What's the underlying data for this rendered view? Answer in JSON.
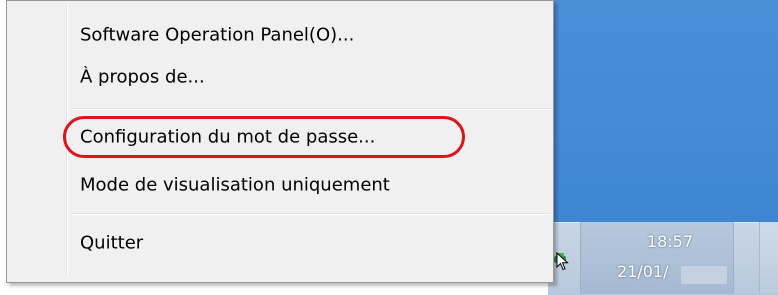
{
  "context_menu": {
    "items": [
      {
        "label": "Software Operation Panel(O)..."
      },
      {
        "label": "À propos de..."
      },
      {
        "label": "Configuration du mot de passe..."
      },
      {
        "label": "Mode de visualisation uniquement"
      },
      {
        "label": "Quitter"
      }
    ]
  },
  "taskbar": {
    "clock_time": "18:57",
    "clock_date": "21/01/"
  },
  "colors": {
    "menu_bg": "#f0f0f0",
    "highlight_ring": "#e0121b",
    "wallpaper": "#4a8ed6"
  },
  "icons": {
    "tray_icon": "scanner-tray-icon",
    "cursor": "mouse-pointer-icon"
  }
}
